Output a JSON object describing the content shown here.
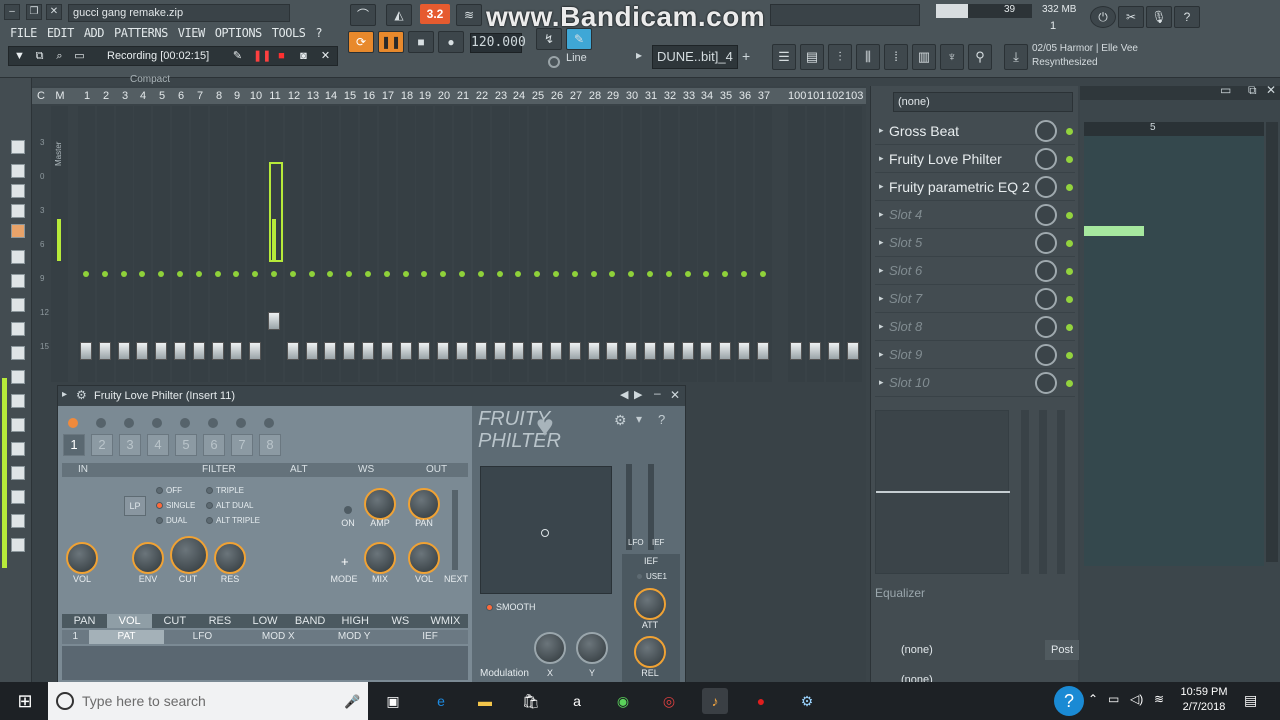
{
  "window": {
    "title": "gucci gang remake.zip"
  },
  "menu": [
    "FILE",
    "EDIT",
    "ADD",
    "PATTERNS",
    "VIEW",
    "OPTIONS",
    "TOOLS",
    "?"
  ],
  "recording": {
    "label": "Recording [00:02:15]"
  },
  "transport": {
    "time_mode": "3.2",
    "bpm": "120.000",
    "snap": "Line",
    "pattern": "DUNE..bit]_4"
  },
  "watermark": "www.Bandicam.com",
  "resources": {
    "cpu": "39",
    "memory": "332 MB",
    "voices": "1"
  },
  "hint": {
    "line1": "02/05  Harmor | Elle Vee",
    "line2": "Resynthesized"
  },
  "mixer": {
    "panel_title": "Compact",
    "header": {
      "c": "C",
      "m": "M"
    },
    "track_numbers": [
      "1",
      "2",
      "3",
      "4",
      "5",
      "6",
      "7",
      "8",
      "9",
      "10",
      "11",
      "12",
      "13",
      "14",
      "15",
      "16",
      "17",
      "18",
      "19",
      "20",
      "21",
      "22",
      "23",
      "24",
      "25",
      "26",
      "27",
      "28",
      "29",
      "30",
      "31",
      "32",
      "33",
      "34",
      "35",
      "36",
      "37"
    ],
    "track_numbers_right": [
      "100",
      "101",
      "102",
      "103"
    ],
    "master_name": "Master",
    "selected_track": "11",
    "scale": [
      "3",
      "0",
      "3",
      "6",
      "9",
      "12",
      "15"
    ]
  },
  "plugin": {
    "title": "Fruity Love Philter (Insert 11)",
    "brand_line1": "FRUITY",
    "brand_line2": "PHILTER",
    "presets": [
      "1",
      "2",
      "3",
      "4",
      "5",
      "6",
      "7",
      "8"
    ],
    "active_preset": "1",
    "sections": {
      "in": "IN",
      "filter": "FILTER",
      "alt": "ALT",
      "ws": "WS",
      "out": "OUT"
    },
    "filter_type": "LP",
    "modes": [
      "OFF",
      "SINGLE",
      "DUAL",
      "TRIPLE",
      "ALT DUAL",
      "ALT TRIPLE"
    ],
    "active_mode": "SINGLE",
    "knobs": {
      "vol": "VOL",
      "env": "ENV",
      "cut": "CUT",
      "res": "RES",
      "amp": "AMP",
      "pan": "PAN",
      "mix": "MIX",
      "out_vol": "VOL",
      "next": "NEXT",
      "on": "ON",
      "mode": "MODE"
    },
    "tabs": [
      "PAN",
      "VOL",
      "CUT",
      "RES",
      "LOW",
      "BAND",
      "HIGH",
      "WS",
      "WMIX"
    ],
    "selected_tab": "VOL",
    "mod_tabs": [
      "1",
      "PAT",
      "LFO",
      "MOD X",
      "MOD Y",
      "IEF"
    ],
    "selected_mod_tab": "PAT",
    "smooth": "SMOOTH",
    "lfo": "LFO",
    "ief": "IEF",
    "ief_title": "IEF",
    "use1": "USE1",
    "att": "ATT",
    "rel": "REL",
    "modulation": "Modulation",
    "x": "X",
    "y": "Y"
  },
  "fx": {
    "preset": "(none)",
    "slots": [
      {
        "name": "Gross Beat",
        "filled": true
      },
      {
        "name": "Fruity Love Philter",
        "filled": true
      },
      {
        "name": "Fruity parametric EQ 2",
        "filled": true
      },
      {
        "name": "Slot 4",
        "filled": false
      },
      {
        "name": "Slot 5",
        "filled": false
      },
      {
        "name": "Slot 6",
        "filled": false
      },
      {
        "name": "Slot 7",
        "filled": false
      },
      {
        "name": "Slot 8",
        "filled": false
      },
      {
        "name": "Slot 9",
        "filled": false
      },
      {
        "name": "Slot 10",
        "filled": false
      }
    ],
    "equalizer": "Equalizer",
    "out_route": "(none)",
    "post": "Post",
    "out_route2": "(none)"
  },
  "playlist": {
    "bar_marker": "5",
    "clip_color": "#a6e89f"
  },
  "taskbar": {
    "search_placeholder": "Type here to search",
    "time": "10:59 PM",
    "date": "2/7/2018"
  },
  "colors": {
    "accent_orange": "#e65b2f",
    "meter_green": "#b7ea3a",
    "knob_ring": "#f0a234"
  }
}
